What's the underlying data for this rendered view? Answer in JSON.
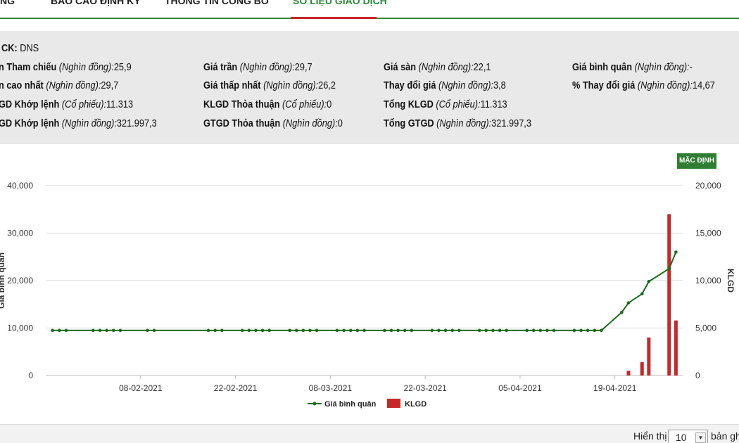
{
  "tabs": [
    {
      "label": "NG"
    },
    {
      "label": "BÁO CÁO ĐỊNH KỲ"
    },
    {
      "label": "THÔNG TIN CÔNG BỐ"
    },
    {
      "label": "SỐ LIỆU GIAO DỊCH"
    }
  ],
  "info": {
    "code": {
      "label": "CK:",
      "value": "DNS"
    },
    "rows": [
      [
        {
          "label": "n Tham chiếu",
          "unit": "(Nghìn đồng):",
          "value": "25,9"
        },
        {
          "label": "Giá trần",
          "unit": "(Nghìn đồng):",
          "value": "29,7"
        },
        {
          "label": "Giá sàn",
          "unit": "(Nghìn đồng):",
          "value": "22,1"
        },
        {
          "label": "Giá bình quân",
          "unit": "(Nghìn đồng):",
          "value": "-"
        }
      ],
      [
        {
          "label": "n cao nhất",
          "unit": "(Nghìn đồng):",
          "value": "29,7"
        },
        {
          "label": "Giá thấp nhất",
          "unit": "(Nghìn đồng):",
          "value": "26,2"
        },
        {
          "label": "Thay đổi giá",
          "unit": "(Nghìn đồng):",
          "value": "3,8"
        },
        {
          "label": "% Thay đổi giá",
          "unit": "(Nghìn đồng):",
          "value": "14,67"
        }
      ],
      [
        {
          "label": "GD Khớp lệnh",
          "unit": "(Cổ phiếu):",
          "value": "11.313"
        },
        {
          "label": "KLGD Thỏa thuận",
          "unit": "(Cổ phiếu):",
          "value": "0"
        },
        {
          "label": "Tổng KLGD",
          "unit": "(Cổ phiếu):",
          "value": "11.313"
        }
      ],
      [
        {
          "label": "GD Khớp lệnh",
          "unit": "(Nghìn đồng):",
          "value": "321.997,3"
        },
        {
          "label": "GTGD Thỏa thuận",
          "unit": "(Nghìn đồng):",
          "value": "0"
        },
        {
          "label": "Tổng GTGD",
          "unit": "(Nghìn đồng):",
          "value": "321.997,3"
        }
      ]
    ]
  },
  "reset_label": "MẶC ĐỊNH",
  "footer": {
    "show_label": "Hiển thị",
    "page_size": "10",
    "rows_label": "bản gh"
  },
  "colors": {
    "accent": "#2e8b3a",
    "line": "#1b6b1b",
    "bar": "#c62828",
    "info_bg": "#e9e9e9"
  },
  "chart_data": {
    "type": "line+bar",
    "left_axis": {
      "label": "Giá bình quân",
      "ticks": [
        "0",
        "10,000",
        "20,000",
        "30,000",
        "40,000"
      ],
      "range": [
        0,
        40000
      ]
    },
    "right_axis": {
      "label": "KLGD",
      "ticks": [
        "0",
        "5,000",
        "10,000",
        "15,000",
        "20,000"
      ],
      "range": [
        0,
        20000
      ]
    },
    "x_ticks": [
      "08-02-2021",
      "22-02-2021",
      "08-03-2021",
      "22-03-2021",
      "05-04-2021",
      "19-04-2021"
    ],
    "x_range": [
      "2021-01-25",
      "2021-04-29"
    ],
    "grid": true,
    "legend_position": "bottom",
    "series": [
      {
        "name": "Giá bình quân",
        "kind": "line",
        "points": [
          [
            "2021-01-26",
            9500
          ],
          [
            "2021-01-27",
            9500
          ],
          [
            "2021-01-28",
            9500
          ],
          [
            "2021-02-01",
            9500
          ],
          [
            "2021-02-02",
            9500
          ],
          [
            "2021-02-03",
            9500
          ],
          [
            "2021-02-04",
            9500
          ],
          [
            "2021-02-05",
            9500
          ],
          [
            "2021-02-09",
            9500
          ],
          [
            "2021-02-10",
            9500
          ],
          [
            "2021-02-18",
            9500
          ],
          [
            "2021-02-19",
            9500
          ],
          [
            "2021-02-20",
            9500
          ],
          [
            "2021-02-23",
            9500
          ],
          [
            "2021-02-24",
            9500
          ],
          [
            "2021-02-25",
            9500
          ],
          [
            "2021-02-26",
            9500
          ],
          [
            "2021-02-27",
            9500
          ],
          [
            "2021-03-02",
            9500
          ],
          [
            "2021-03-03",
            9500
          ],
          [
            "2021-03-04",
            9500
          ],
          [
            "2021-03-05",
            9500
          ],
          [
            "2021-03-06",
            9500
          ],
          [
            "2021-03-09",
            9500
          ],
          [
            "2021-03-10",
            9500
          ],
          [
            "2021-03-11",
            9500
          ],
          [
            "2021-03-12",
            9500
          ],
          [
            "2021-03-13",
            9500
          ],
          [
            "2021-03-16",
            9500
          ],
          [
            "2021-03-17",
            9500
          ],
          [
            "2021-03-18",
            9500
          ],
          [
            "2021-03-19",
            9500
          ],
          [
            "2021-03-20",
            9500
          ],
          [
            "2021-03-23",
            9500
          ],
          [
            "2021-03-24",
            9500
          ],
          [
            "2021-03-25",
            9500
          ],
          [
            "2021-03-26",
            9500
          ],
          [
            "2021-03-27",
            9500
          ],
          [
            "2021-03-30",
            9500
          ],
          [
            "2021-03-31",
            9500
          ],
          [
            "2021-04-01",
            9500
          ],
          [
            "2021-04-02",
            9500
          ],
          [
            "2021-04-03",
            9500
          ],
          [
            "2021-04-06",
            9500
          ],
          [
            "2021-04-07",
            9500
          ],
          [
            "2021-04-08",
            9500
          ],
          [
            "2021-04-09",
            9500
          ],
          [
            "2021-04-10",
            9500
          ],
          [
            "2021-04-13",
            9500
          ],
          [
            "2021-04-14",
            9500
          ],
          [
            "2021-04-15",
            9500
          ],
          [
            "2021-04-16",
            9500
          ],
          [
            "2021-04-17",
            9500
          ],
          [
            "2021-04-20",
            13300
          ],
          [
            "2021-04-21",
            15300
          ],
          [
            "2021-04-23",
            17200
          ],
          [
            "2021-04-24",
            19800
          ],
          [
            "2021-04-27",
            22500
          ],
          [
            "2021-04-28",
            26000
          ]
        ]
      },
      {
        "name": "KLGD",
        "kind": "bar",
        "points": [
          [
            "2021-04-21",
            500
          ],
          [
            "2021-04-23",
            1400
          ],
          [
            "2021-04-24",
            4000
          ],
          [
            "2021-04-27",
            17000
          ],
          [
            "2021-04-28",
            5800
          ]
        ]
      }
    ]
  }
}
